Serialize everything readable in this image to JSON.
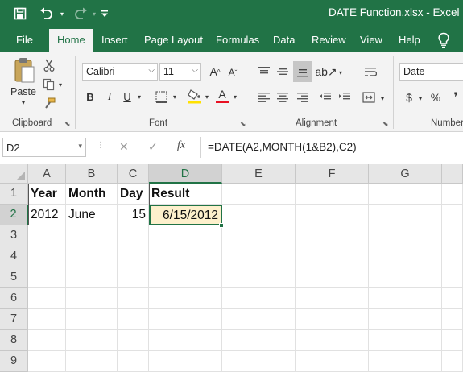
{
  "title_bar": {
    "title": "DATE Function.xlsx - Excel",
    "icons": [
      "save-icon",
      "undo-icon",
      "redo-icon",
      "customize-quick-access-icon"
    ],
    "background": "#217346"
  },
  "tabs": [
    {
      "label": "File",
      "active": false
    },
    {
      "label": "Home",
      "active": true
    },
    {
      "label": "Insert",
      "active": false
    },
    {
      "label": "Page Layout",
      "active": false
    },
    {
      "label": "Formulas",
      "active": false
    },
    {
      "label": "Data",
      "active": false
    },
    {
      "label": "Review",
      "active": false
    },
    {
      "label": "View",
      "active": false
    },
    {
      "label": "Help",
      "active": false
    }
  ],
  "ribbon": {
    "clipboard": {
      "paste_label": "Paste",
      "group_label": "Clipboard"
    },
    "font": {
      "font_name": "Calibri",
      "font_size": "11",
      "bold": "B",
      "italic": "I",
      "underline": "U",
      "grow": "A",
      "shrink": "A",
      "font_color": "A",
      "group_label": "Font",
      "font_color_value": "#e81123"
    },
    "alignment": {
      "group_label": "Alignment"
    },
    "number": {
      "format": "Date",
      "currency": "$",
      "percent": "%",
      "group_label": "Number"
    }
  },
  "formula_bar": {
    "name_box": "D2",
    "cancel": "✕",
    "enter": "✓",
    "fx": "fx",
    "formula": "=DATE(A2,MONTH(1&B2),C2)"
  },
  "sheet": {
    "columns": [
      "A",
      "B",
      "C",
      "D",
      "E",
      "F",
      "G"
    ],
    "rows": [
      "1",
      "2",
      "3",
      "4",
      "5",
      "6",
      "7",
      "8",
      "9"
    ],
    "cells": {
      "A1": "Year",
      "B1": "Month",
      "C1": "Day",
      "D1": "Result",
      "A2": "2012",
      "B2": "June",
      "C2": "15",
      "D2": "6/15/2012"
    },
    "selected_cell": "D2",
    "accent": "#217346",
    "result_fill": "#fdf0cc"
  }
}
